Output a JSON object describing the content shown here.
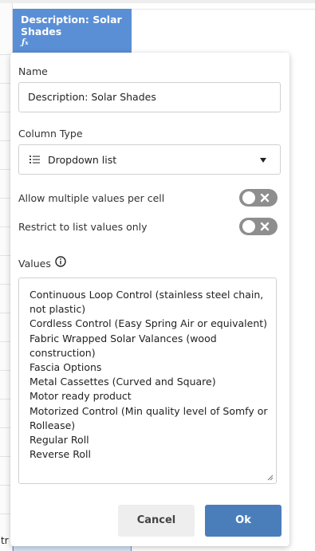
{
  "column_header": {
    "title": "Description: Solar Shades",
    "formula_icon": "fx-icon"
  },
  "background": {
    "cut_off_text": "tr"
  },
  "panel": {
    "name_label": "Name",
    "name_value": "Description: Solar Shades",
    "column_type_label": "Column Type",
    "column_type_value": "Dropdown list",
    "column_type_icon": "list-icon",
    "allow_multiple_label": "Allow multiple values per cell",
    "allow_multiple_on": false,
    "restrict_label": "Restrict to list values only",
    "restrict_on": false,
    "values_label": "Values",
    "values_info_icon": "info-icon",
    "values": [
      "Continuous Loop Control (stainless steel chain, not plastic)",
      "Cordless Control (Easy Spring Air or equivalent)",
      "Fabric Wrapped Solar Valances (wood construction)",
      "Fascia Options",
      "Metal Cassettes (Curved and Square)",
      "Motor ready product",
      "Motorized Control (Min quality level of Somfy or Rollease)",
      "Regular Roll",
      "Reverse Roll"
    ],
    "cancel_label": "Cancel",
    "ok_label": "Ok"
  },
  "colors": {
    "header_blue": "#5a8fd6",
    "ok_button": "#4a7ebb",
    "toggle_off": "#8e8e8e"
  }
}
